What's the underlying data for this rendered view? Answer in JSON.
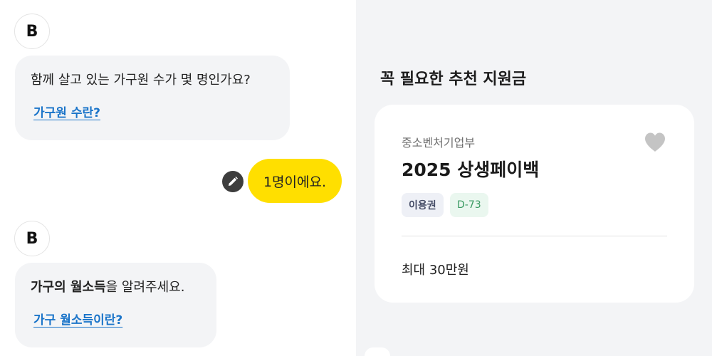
{
  "chat": {
    "avatar_glyph": "B",
    "messages": [
      {
        "role": "bot",
        "text": "함께 살고 있는 가구원 수가 몇 명인가요?",
        "link": "가구원 수란?"
      },
      {
        "role": "user",
        "text": "1명이에요."
      },
      {
        "role": "bot",
        "bold_text": "가구의 월소득",
        "text": "을 알려주세요.",
        "link": "가구 월소득이란?"
      }
    ],
    "colors": {
      "user_bubble": "#ffdf00",
      "bot_bubble": "#f3f4f6",
      "link": "#1a74c9"
    }
  },
  "panel": {
    "title": "꼭 필요한 추천 지원금",
    "card": {
      "org": "중소벤처기업부",
      "name": "2025 상생페이백",
      "tags": [
        "이용권",
        "D-73"
      ],
      "amount": "최대 30만원",
      "favorite_icon": "heart-icon"
    }
  }
}
